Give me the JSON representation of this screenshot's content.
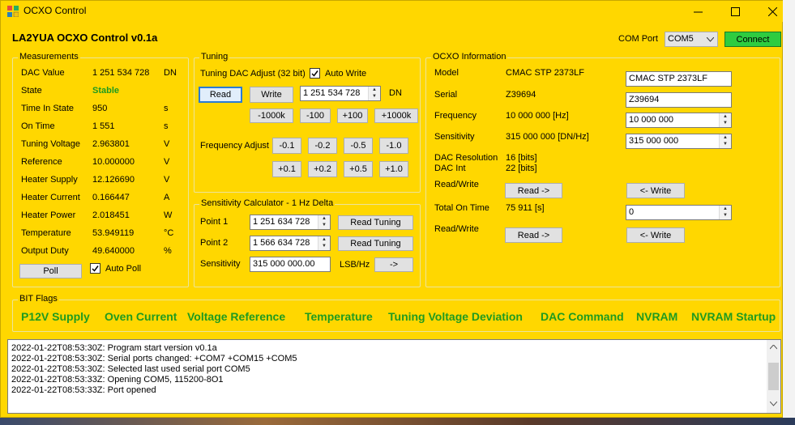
{
  "window": {
    "title": "OCXO Control",
    "app_title": "LA2YUA OCXO Control v0.1a"
  },
  "com": {
    "label": "COM Port",
    "value": "COM5",
    "connect_label": "Connect"
  },
  "measurements": {
    "group_label": "Measurements",
    "rows": [
      {
        "label": "DAC Value",
        "value": "1 251 534 728",
        "unit": "DN"
      },
      {
        "label": "State",
        "value": "Stable",
        "unit": ""
      },
      {
        "label": "Time In State",
        "value": "950",
        "unit": "s"
      },
      {
        "label": "On Time",
        "value": "1 551",
        "unit": "s"
      },
      {
        "label": "Tuning Voltage",
        "value": "2.963801",
        "unit": "V"
      },
      {
        "label": "Reference",
        "value": "10.000000",
        "unit": "V"
      },
      {
        "label": "Heater Supply",
        "value": "12.126690",
        "unit": "V"
      },
      {
        "label": "Heater Current",
        "value": "0.166447",
        "unit": "A"
      },
      {
        "label": "Heater Power",
        "value": "2.018451",
        "unit": "W"
      },
      {
        "label": "Temperature",
        "value": "53.949119",
        "unit": "°C"
      },
      {
        "label": "Output Duty",
        "value": "49.640000",
        "unit": "%"
      }
    ],
    "poll_label": "Poll",
    "auto_poll_label": "Auto Poll"
  },
  "tuning": {
    "group_label": "Tuning",
    "dac_adjust_label": "Tuning DAC Adjust (32 bit)",
    "auto_write_label": "Auto Write",
    "read_label": "Read",
    "write_label": "Write",
    "dac_value": "1 251 534 728",
    "dn_label": "DN",
    "step_buttons": [
      "-1000k",
      "-100",
      "+100",
      "+1000k"
    ],
    "freq_adjust_label": "Frequency Adjust",
    "freq_neg": [
      "-0.1",
      "-0.2",
      "-0.5",
      "-1.0"
    ],
    "freq_pos": [
      "+0.1",
      "+0.2",
      "+0.5",
      "+1.0"
    ]
  },
  "sensitivity_calc": {
    "group_label": "Sensitivity Calculator - 1 Hz Delta",
    "point1_label": "Point 1",
    "point1_value": "1 251 634 728",
    "point2_label": "Point 2",
    "point2_value": "1 566 634 728",
    "read_tuning_label": "Read Tuning",
    "sensitivity_label": "Sensitivity",
    "sensitivity_value": "315 000 000.00",
    "unit_label": "LSB/Hz",
    "apply_label": "->"
  },
  "ocxo_info": {
    "group_label": "OCXO Information",
    "model_label": "Model",
    "model_value": "CMAC STP 2373LF",
    "model_input": "CMAC STP 2373LF",
    "serial_label": "Serial",
    "serial_value": "Z39694",
    "serial_input": "Z39694",
    "frequency_label": "Frequency",
    "frequency_value": "10 000 000 [Hz]",
    "frequency_input": "10 000 000",
    "sensitivity_label": "Sensitivity",
    "sensitivity_value": "315 000 000 [DN/Hz]",
    "sensitivity_input": "315 000 000",
    "dac_res_label": "DAC Resolution",
    "dac_res_value": "16 [bits]",
    "dac_int_label": "DAC Int",
    "dac_int_value": "22 [bits]",
    "rw_label": "Read/Write",
    "read_label": "Read ->",
    "write_label": "<- Write",
    "total_on_label": "Total On Time",
    "total_on_value": "75 911 [s]",
    "total_on_input": "0",
    "rw2_label": "Read/Write"
  },
  "bit_flags": {
    "group_label": "BIT Flags",
    "flags": [
      "P12V Supply",
      "Oven Current",
      "Voltage Reference",
      "Temperature",
      "Tuning Voltage Deviation",
      "DAC Command",
      "NVRAM",
      "NVRAM Startup"
    ],
    "color": "#1f9b1f"
  },
  "log": [
    "2022-01-22T08:53:30Z: Program start version v0.1a",
    "2022-01-22T08:53:30Z: Serial ports changed: +COM7 +COM15 +COM5",
    "2022-01-22T08:53:30Z: Selected last used serial port COM5",
    "2022-01-22T08:53:33Z: Opening COM5, 115200-8O1",
    "2022-01-22T08:53:33Z: Port opened"
  ],
  "colors": {
    "background": "#FFD700",
    "connect": "#2ecc40",
    "stable": "#1f9b1f"
  }
}
